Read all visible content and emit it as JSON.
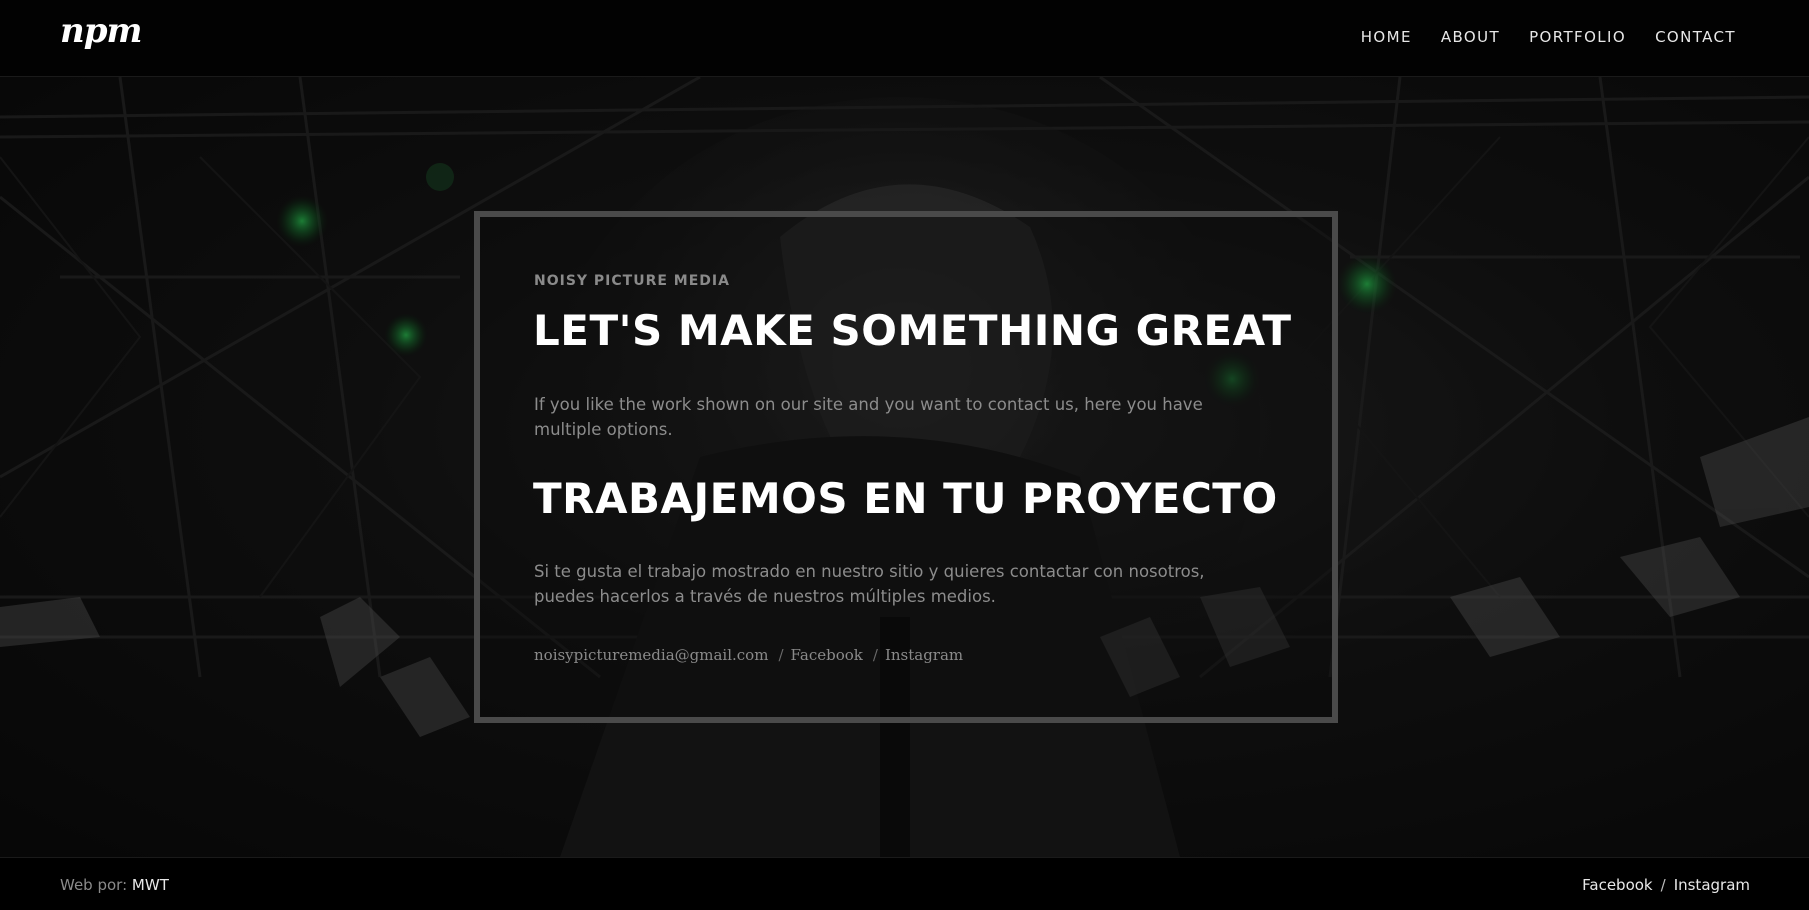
{
  "header": {
    "logo_text": "npm",
    "nav": [
      "HOME",
      "ABOUT",
      "PORTFOLIO",
      "CONTACT"
    ]
  },
  "hero": {
    "kicker": "NOISY PICTURE MEDIA",
    "heading_en": "LET'S MAKE SOMETHING GREAT",
    "text_en": "If you like the work shown on our site and you want to contact us, here you have multiple options.",
    "heading_es": "TRABAJEMOS EN TU PROYECTO",
    "text_es": "Si te gusta el trabajo mostrado en nuestro sitio y quieres contactar con nosotros, puedes hacerlos a través de nuestros múltiples medios.",
    "links": {
      "email": "noisypicturemedia@gmail.com",
      "facebook": "Facebook",
      "instagram": "Instagram",
      "separator": "/"
    }
  },
  "footer": {
    "credit_prefix": "Web por:",
    "credit_name": "MWT",
    "facebook": "Facebook",
    "instagram": "Instagram",
    "separator": "/"
  },
  "colors": {
    "background": "#000000",
    "heading": "#ffffff",
    "muted_text": "#8c8c8c",
    "frame_border": "#4a4a4a",
    "stage_light_green": "#1f9a3a"
  },
  "icons": {
    "logo": "npm-blackletter-logo"
  }
}
